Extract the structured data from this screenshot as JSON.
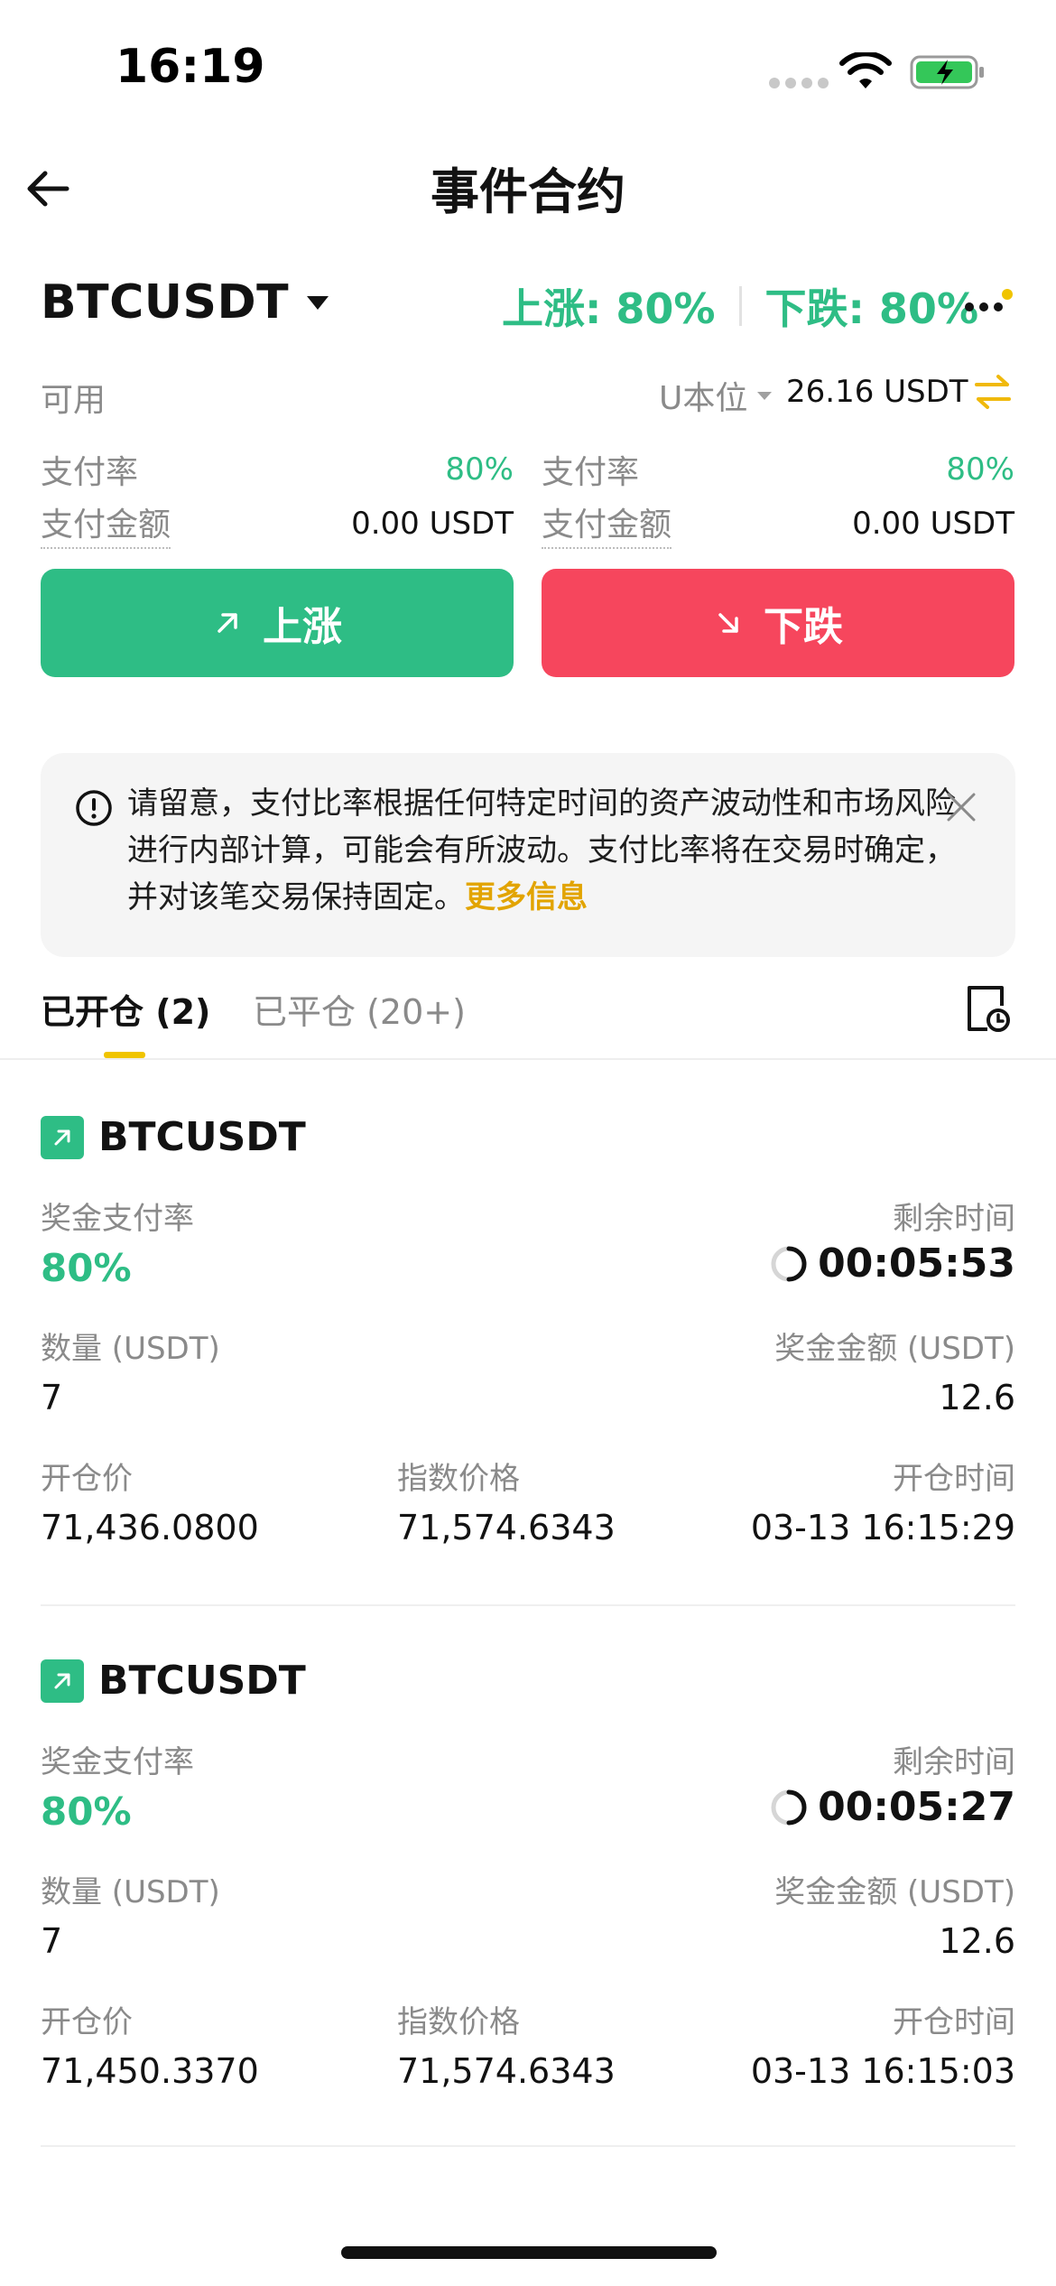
{
  "status_bar": {
    "time": "16:19"
  },
  "nav": {
    "title": "事件合约"
  },
  "ticker": {
    "pair": "BTCUSDT",
    "up_rate": "上涨: 80%",
    "down_rate": "下跌: 80%"
  },
  "available": {
    "label": "可用",
    "unit": "U本位",
    "value": "26.16 USDT"
  },
  "pay_up": {
    "rate_label": "支付率",
    "rate_value": "80%",
    "amount_label": "支付金额",
    "amount_value": "0.00 USDT"
  },
  "pay_down": {
    "rate_label": "支付率",
    "rate_value": "80%",
    "amount_label": "支付金额",
    "amount_value": "0.00 USDT"
  },
  "buttons": {
    "up": "上涨",
    "down": "下跌"
  },
  "notice": {
    "text": "请留意，支付比率根据任何特定时间的资产波动性和市场风险进行内部计算，可能会有所波动。支付比率将在交易时确定，并对该笔交易保持固定。",
    "more": "更多信息"
  },
  "tabs": {
    "open": "已开仓 (2)",
    "closed": "已平仓 (20+)"
  },
  "labels": {
    "bonus_rate": "奖金支付率",
    "remaining_time": "剩余时间",
    "quantity": "数量 (USDT)",
    "bonus_amount": "奖金金额 (USDT)",
    "open_price": "开仓价",
    "index_price": "指数价格",
    "open_time": "开仓时间"
  },
  "positions": [
    {
      "pair": "BTCUSDT",
      "bonus_rate": "80%",
      "remaining": "00:05:53",
      "quantity": "7",
      "bonus_amount": "12.6",
      "open_price": "71,436.0800",
      "index_price": "71,574.6343",
      "open_time": "03-13 16:15:29"
    },
    {
      "pair": "BTCUSDT",
      "bonus_rate": "80%",
      "remaining": "00:05:27",
      "quantity": "7",
      "bonus_amount": "12.6",
      "open_price": "71,450.3370",
      "index_price": "71,574.6343",
      "open_time": "03-13 16:15:03"
    }
  ],
  "colors": {
    "up": "#2ebd85",
    "down": "#f6465d",
    "accent": "#f0c400",
    "link": "#e2a400"
  },
  "icons": {
    "back": "arrow-left-icon",
    "dropdown": "caret-down-icon",
    "more": "more-dots-icon",
    "swap": "swap-icon",
    "info": "info-icon",
    "close": "close-icon",
    "history": "history-icon",
    "timer": "timer-spinner-icon"
  }
}
